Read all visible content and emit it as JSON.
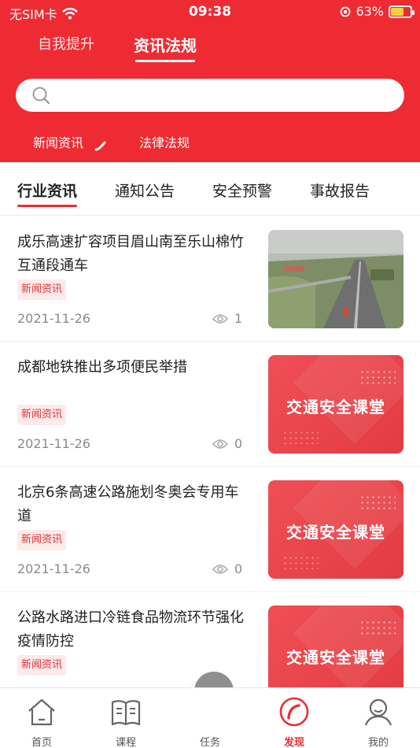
{
  "status_bar": {
    "carrier": "无SIM卡",
    "time": "09:38",
    "battery": "63%",
    "battery_level": 0.63
  },
  "top_tabs": [
    "自我提升",
    "资讯法规"
  ],
  "search": {
    "placeholder": ""
  },
  "sub_tabs": [
    "新闻资讯",
    "法律法规"
  ],
  "category_tabs": [
    "行业资讯",
    "通知公告",
    "安全预警",
    "事故报告"
  ],
  "news": [
    {
      "title": "成乐高速扩容项目眉山南至乐山棉竹互通段通车",
      "tag": "新闻资讯",
      "date": "2021-11-26",
      "views": "1",
      "thumb": "highway-photo"
    },
    {
      "title": "成都地铁推出多项便民举措",
      "tag": "新闻资讯",
      "date": "2021-11-26",
      "views": "0",
      "thumb": "交通安全课堂"
    },
    {
      "title": "北京6条高速公路施划冬奥会专用车道",
      "tag": "新闻资讯",
      "date": "2021-11-26",
      "views": "0",
      "thumb": "交通安全课堂"
    },
    {
      "title": "公路水路进口冷链食品物流环节强化疫情防控",
      "tag": "新闻资讯",
      "date": "",
      "views": "",
      "thumb": "交通安全课堂"
    }
  ],
  "tabbar": [
    "首页",
    "课程",
    "任务",
    "发现",
    "我的"
  ],
  "colors": {
    "brand_red": "#ee2b33",
    "tag_bg": "#fdeaea"
  }
}
